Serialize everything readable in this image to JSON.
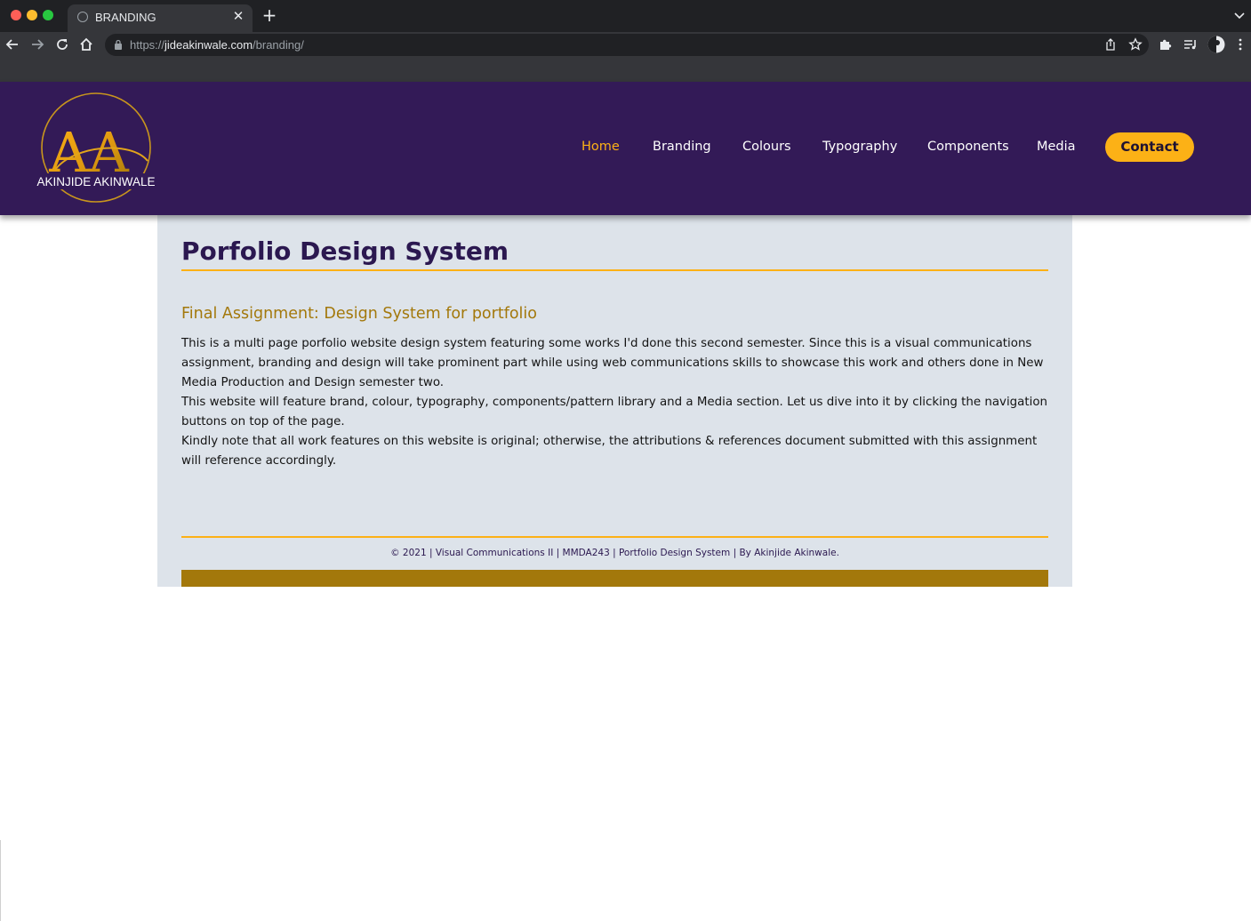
{
  "browser": {
    "tab_title": "BRANDING",
    "url_scheme": "https://",
    "url_host": "jideakinwale.com",
    "url_path": "/branding/"
  },
  "header": {
    "logo_monogram": "AA",
    "logo_text": "AKINJIDE AKINWALE",
    "nav": [
      {
        "label": "Home",
        "active": true
      },
      {
        "label": "Branding"
      },
      {
        "label": "Colours"
      },
      {
        "label": "Typography"
      },
      {
        "label": "Components"
      },
      {
        "label": "Media"
      }
    ],
    "contact_label": "Contact"
  },
  "main": {
    "title": "Porfolio Design System",
    "subtitle": "Final Assignment: Design System for portfolio",
    "paragraphs": [
      "This is a multi page porfolio website design system featuring some works I'd done this second semester. Since this is a visual communications assignment, branding and design will take prominent part while using web communications skills to showcase this work and others done in New Media Production and Design semester two.",
      "This website will feature brand, colour, typography, components/pattern library and a Media section. Let us dive into it by clicking the navigation buttons on top of the page.",
      "Kindly note that all work features on this website is original; otherwise, the attributions & references document submitted with this assignment will reference accordingly."
    ]
  },
  "footer": {
    "text": "© 2021 | Visual Communications II | MMDA243 | Portfolio Design System | By Akinjide Akinwale."
  },
  "colors": {
    "brand_purple": "#331a57",
    "brand_gold": "#fcb116",
    "dark_gold": "#a3780b",
    "content_bg": "#dde3ea"
  },
  "icons": [
    "back-arrow-icon",
    "forward-arrow-icon",
    "reload-icon",
    "home-icon",
    "lock-icon",
    "share-icon",
    "star-icon",
    "extensions-puzzle-icon",
    "media-queue-icon",
    "profile-avatar-icon",
    "kebab-menu-icon",
    "tab-close-icon",
    "new-tab-plus-icon",
    "tab-list-chevron-icon",
    "globe-favicon-icon"
  ]
}
